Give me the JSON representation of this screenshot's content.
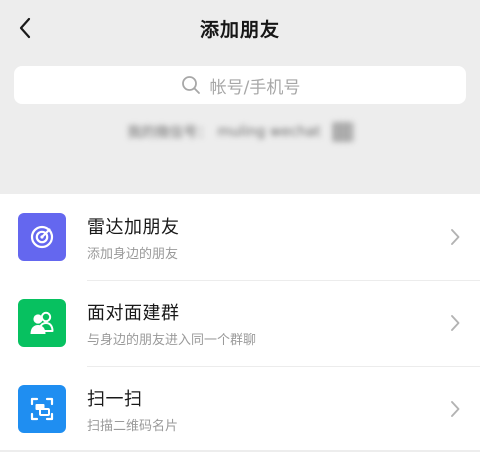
{
  "header": {
    "title": "添加朋友",
    "back_icon": "chevron-left-icon"
  },
  "search": {
    "placeholder": "帐号/手机号",
    "icon": "search-icon"
  },
  "my_account": {
    "label": "我的微信号：",
    "value": "muling wechat",
    "icon": "qr-code-icon",
    "blurred": true
  },
  "items": [
    {
      "title": "雷达加朋友",
      "subtitle": "添加身边的朋友",
      "icon": "radar-icon",
      "color": "#6467ef"
    },
    {
      "title": "面对面建群",
      "subtitle": "与身边的朋友进入同一个群聊",
      "icon": "group-icon",
      "color": "#07c160"
    },
    {
      "title": "扫一扫",
      "subtitle": "扫描二维码名片",
      "icon": "scan-icon",
      "color": "#1f8ef1"
    }
  ],
  "colors": {
    "page_bg": "#ededed",
    "card_bg": "#ffffff",
    "title_text": "#161616",
    "secondary_text": "#9a9a9a"
  }
}
